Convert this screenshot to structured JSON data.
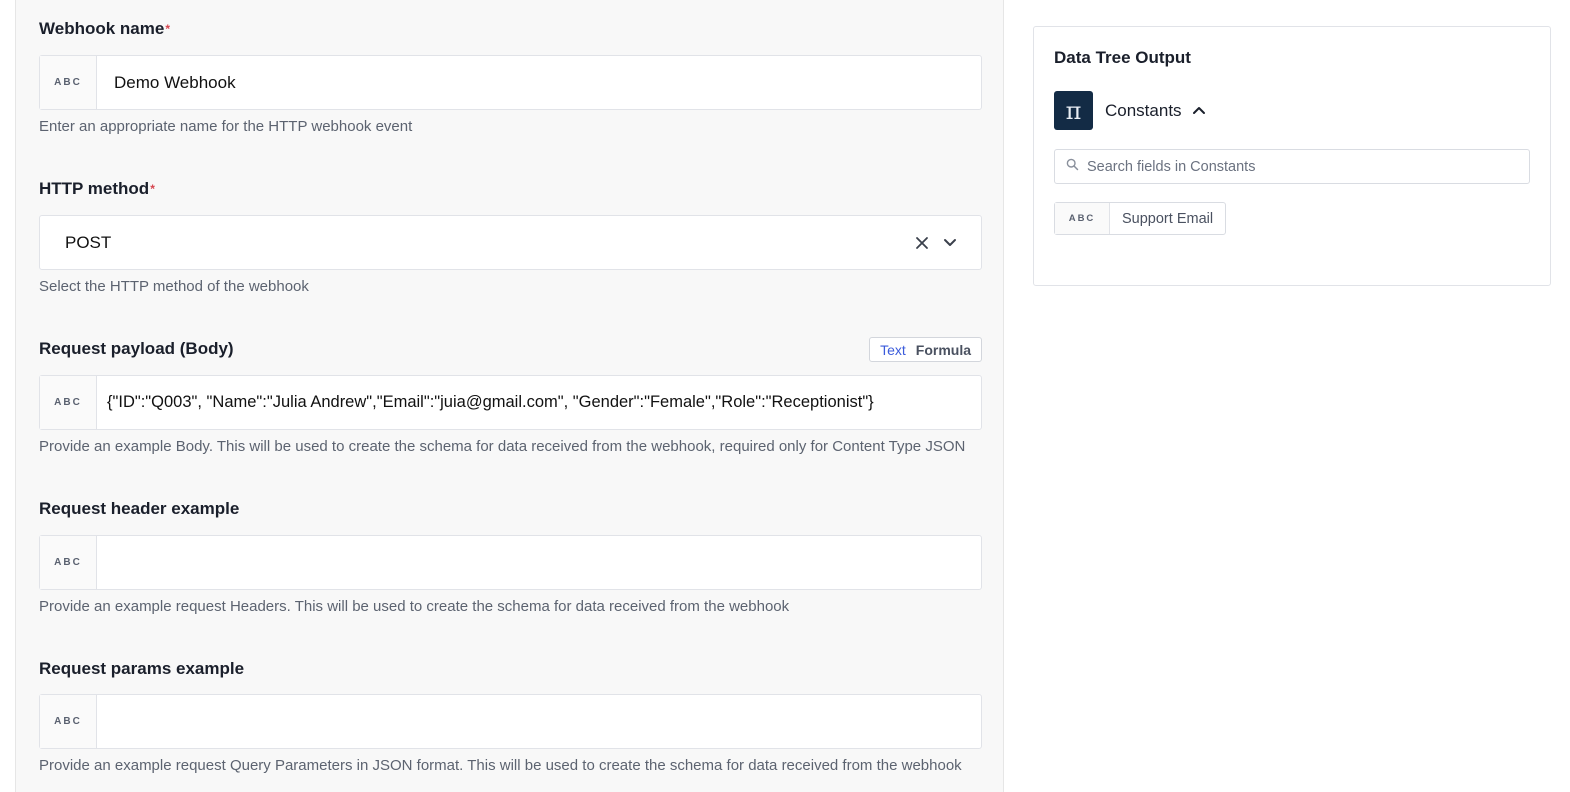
{
  "form": {
    "webhook_name": {
      "label": "Webhook name",
      "required_mark": "*",
      "type_tag": "ABC",
      "value": "Demo Webhook",
      "help": "Enter an appropriate name for the HTTP webhook event"
    },
    "http_method": {
      "label": "HTTP method",
      "required_mark": "*",
      "value": "POST",
      "help": "Select the HTTP method of the webhook",
      "clear_icon": "close-icon",
      "dropdown_icon": "chevron-down-icon"
    },
    "request_payload": {
      "label": "Request payload (Body)",
      "toggle_text": "Text",
      "toggle_formula": "Formula",
      "type_tag": "ABC",
      "value": "{\"ID\":\"Q003\", \"Name\":\"Julia Andrew\",\"Email\":\"juia@gmail.com\", \"Gender\":\"Female\",\"Role\":\"Receptionist\"}",
      "help": "Provide an example Body. This will be used to create the schema for data received from the webhook, required only for Content Type JSON"
    },
    "request_header": {
      "label": "Request header example",
      "type_tag": "ABC",
      "value": "",
      "help": "Provide an example request Headers. This will be used to create the schema for data received from the webhook"
    },
    "request_params": {
      "label": "Request params example",
      "type_tag": "ABC",
      "value": "",
      "help": "Provide an example request Query Parameters in JSON format. This will be used to create the schema for data received from the webhook"
    }
  },
  "data_tree": {
    "title": "Data Tree Output",
    "group_icon": "pi-icon",
    "group_icon_glyph": "π",
    "group_label": "Constants",
    "search_placeholder": "Search fields in Constants",
    "fields": [
      {
        "type_tag": "ABC",
        "label": "Support Email"
      }
    ]
  },
  "colors": {
    "required": "#d6454f",
    "toggle_active": "#3b5bdb",
    "pi_bg": "#132b45"
  }
}
